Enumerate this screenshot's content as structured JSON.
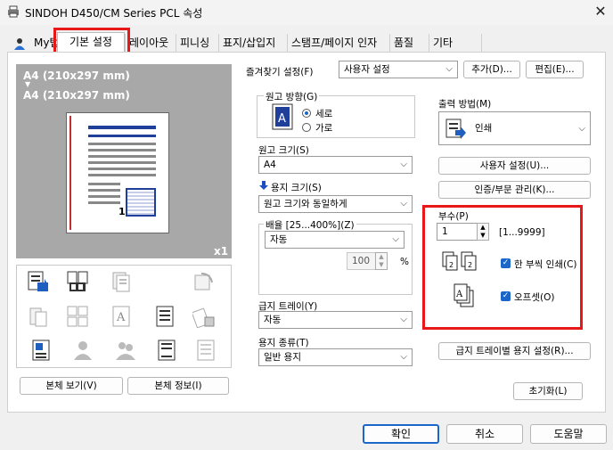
{
  "window": {
    "title": "SINDOH D450/CM Series PCL 속성"
  },
  "tabs": [
    {
      "label": "My탭"
    },
    {
      "label": "기본 설정"
    },
    {
      "label": "레이아웃"
    },
    {
      "label": "피니싱"
    },
    {
      "label": "표지/삽입지"
    },
    {
      "label": "스탬프/페이지 인자"
    },
    {
      "label": "품질"
    },
    {
      "label": "기타"
    }
  ],
  "preview": {
    "paper_top": "A4 (210x297 mm)",
    "arrow": "▼",
    "paper_bottom": "A4 (210x297 mm)",
    "copies": "x1",
    "page_number": "1"
  },
  "buttons": {
    "preview_view": "본체 보기(V)",
    "device_info": "본체 정보(I)",
    "add": "추가(D)...",
    "edit": "편집(E)...",
    "user_settings": "사용자 설정(U)...",
    "auth_account": "인증/부문 관리(K)...",
    "tray_paper": "급지 트레이별 용지 설정(R)...",
    "reset": "초기화(L)",
    "ok": "확인",
    "cancel": "취소",
    "help": "도움말"
  },
  "favorites": {
    "label": "즐겨찾기 설정(F)",
    "value": "사용자 설정"
  },
  "orientation": {
    "label": "원고 방향(G)",
    "portrait": "세로",
    "landscape": "가로"
  },
  "original_size": {
    "label": "원고 크기(S)",
    "value": "A4"
  },
  "paper_size": {
    "label": "용지 크기(S)",
    "value": "원고 크기와 동일하게"
  },
  "zoom": {
    "label": "배율 [25...400%](Z)",
    "mode": "자동",
    "value": "100",
    "unit": "%"
  },
  "paper_tray": {
    "label": "급지 트레이(Y)",
    "value": "자동"
  },
  "paper_type": {
    "label": "용지 종류(T)",
    "value": "일반 용지"
  },
  "output_method": {
    "label": "출력 방법(M)",
    "value": "인쇄"
  },
  "copies": {
    "label": "부수(P)",
    "value": "1",
    "range": "[1...9999]",
    "collate": "한 부씩 인쇄(C)",
    "offset": "오프셋(O)"
  },
  "colors": {
    "highlight": "#e81818",
    "accent": "#1a67c9"
  }
}
